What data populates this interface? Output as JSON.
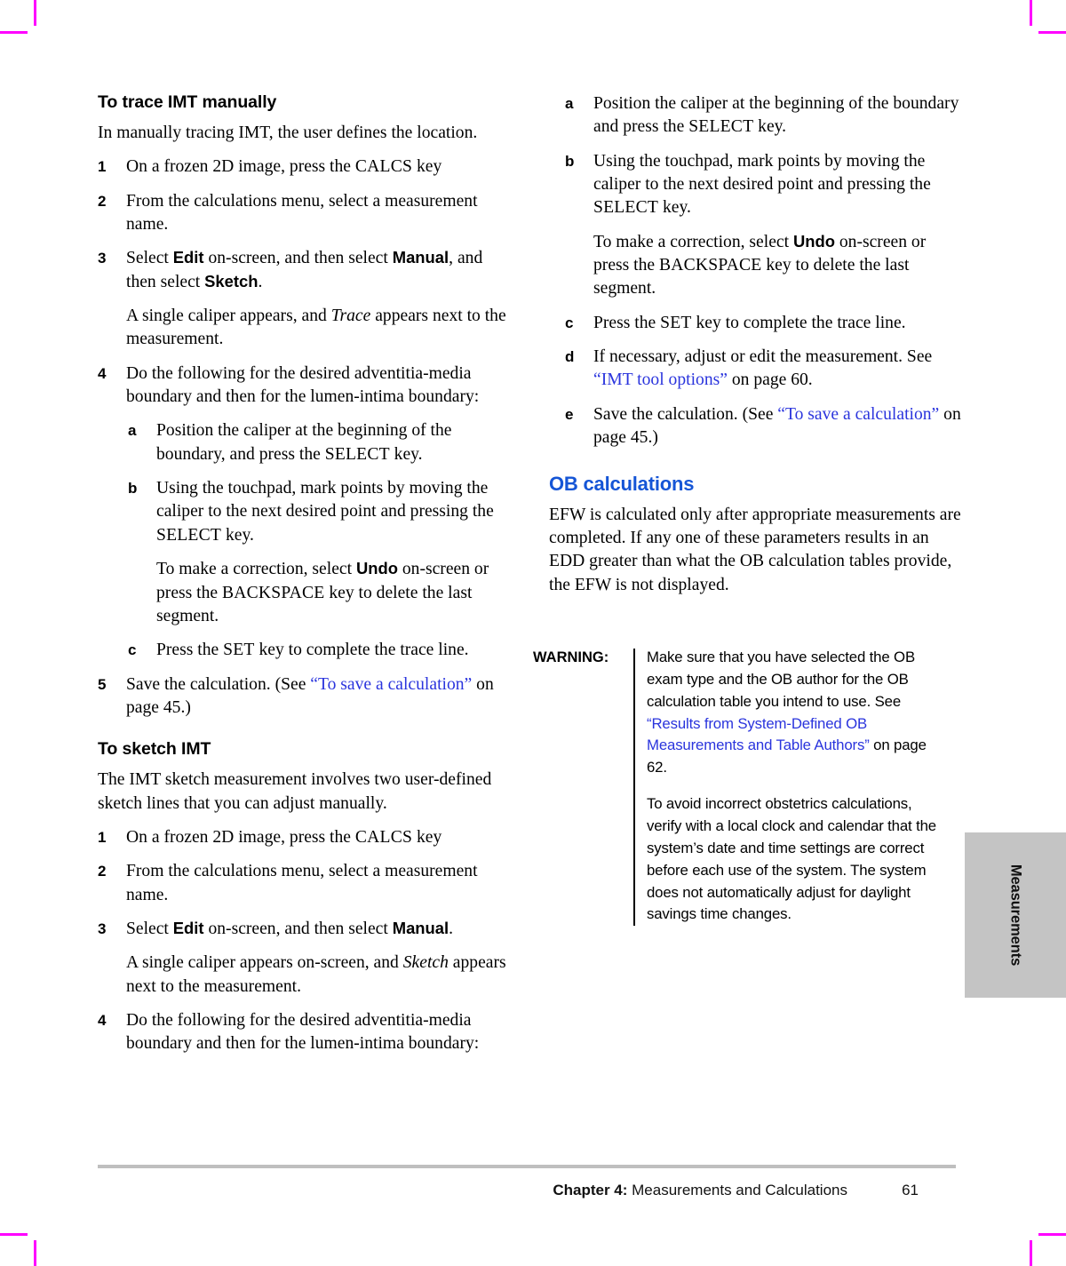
{
  "document": {
    "side_tab_label": "Measurements",
    "footer": {
      "chapter_label": "Chapter 4:",
      "chapter_title": "Measurements and Calculations",
      "page_number": "61"
    },
    "colors": {
      "link": "#2a34dd",
      "heading_accent": "#1555d6",
      "side_tab_bg": "#c4c4c4",
      "footer_rule": "#bfbfbf",
      "crop_mark": "#ff00ff"
    }
  },
  "left_column": {
    "heading_trace": "To trace IMT manually",
    "intro_trace": "In manually tracing IMT, the user defines the location.",
    "trace_steps": {
      "n1_marker": "1",
      "n1_a": "On a frozen 2D image, press the ",
      "n1_key": "CALCS",
      "n1_b": " key",
      "n2_marker": "2",
      "n2_text": "From the calculations menu, select a measurement name.",
      "n3_marker": "3",
      "n3_a": "Select ",
      "n3_bold1": "Edit",
      "n3_b": " on-screen, and then select ",
      "n3_bold2": "Manual",
      "n3_c": ", and then select ",
      "n3_bold3": "Sketch",
      "n3_d": ".",
      "n3_note_a": "A single caliper appears, and ",
      "n3_note_italic": "Trace",
      "n3_note_b": " appears next to the measurement.",
      "n4_marker": "4",
      "n4_text": "Do the following for the desired adventitia-media boundary and then for the lumen-intima boundary:",
      "a_marker": "a",
      "a_a": "Position the caliper at the beginning of the boundary, and press the ",
      "a_key": "SELECT",
      "a_b": " key.",
      "b_marker": "b",
      "b_a": "Using the touchpad, mark points by moving the caliper to the next desired point and pressing the ",
      "b_key": "SELECT",
      "b_b": " key.",
      "b_note_a": "To make a correction, select ",
      "b_note_bold": "Undo",
      "b_note_b": " on-screen or press the ",
      "b_note_key": "BACKSPACE",
      "b_note_c": " key to delete the last segment.",
      "c_marker": "c",
      "c_a": "Press the ",
      "c_key": "SET",
      "c_b": " key to complete the trace line.",
      "n5_marker": "5",
      "n5_a": "Save the calculation. (See ",
      "n5_link": "“To save a calculation”",
      "n5_b": " on page 45.)"
    },
    "heading_sketch": "To sketch IMT",
    "intro_sketch": "The IMT sketch measurement involves two user-defined sketch lines that you can adjust manually.",
    "sketch_steps": {
      "n1_marker": "1",
      "n1_a": "On a frozen 2D image, press the ",
      "n1_key": "CALCS",
      "n1_b": " key",
      "n2_marker": "2",
      "n2_text": "From the calculations menu, select a measurement name.",
      "n3_marker": "3",
      "n3_a": "Select ",
      "n3_bold1": "Edit",
      "n3_b": " on-screen, and then select ",
      "n3_bold2": "Manual",
      "n3_c": ".",
      "n3_note_a": "A single caliper appears on-screen, and ",
      "n3_note_italic": "Sketch",
      "n3_note_b": " appears next to the measurement.",
      "n4_marker": "4",
      "n4_text": "Do the following for the desired adventitia-media boundary and then for the lumen-intima boundary:"
    }
  },
  "right_column": {
    "sketch_substeps": {
      "a_marker": "a",
      "a_a": "Position the caliper at the beginning of the boundary and press the ",
      "a_key": "SELECT",
      "a_b": " key.",
      "b_marker": "b",
      "b_a": "Using the touchpad, mark points by moving the caliper to the next desired point and pressing the ",
      "b_key": "SELECT",
      "b_b": " key.",
      "b_note_a": "To make a correction, select ",
      "b_note_bold": "Undo",
      "b_note_b": " on-screen or press the ",
      "b_note_key": "BACKSPACE",
      "b_note_c": " key to delete the last segment.",
      "c_marker": "c",
      "c_a": "Press the ",
      "c_key": "SET",
      "c_b": " key to complete the trace line.",
      "d_marker": "d",
      "d_a": "If necessary, adjust or edit the measurement. See ",
      "d_link": "“IMT tool options”",
      "d_b": " on page 60.",
      "e_marker": "e",
      "e_a": "Save the calculation. (See ",
      "e_link": "“To save a calculation”",
      "e_b": " on page 45.)"
    },
    "heading_ob": "OB calculations",
    "intro_ob": "EFW is calculated only after appropriate measurements are completed. If any one of these parameters results in an EDD greater than what the OB calculation tables provide, the EFW is not displayed.",
    "warning": {
      "label": "WARNING:",
      "para1_a": "Make sure that you have selected the OB exam type and the OB author for the OB calculation table you intend to use. See ",
      "para1_link": "“Results from System-Defined OB Measurements and Table Authors”",
      "para1_b": " on page 62.",
      "para2": "To avoid incorrect obstetrics calculations, verify with a local clock and calendar that the system’s date and time settings are correct before each use of the system. The system does not automatically adjust for daylight savings time changes."
    }
  }
}
